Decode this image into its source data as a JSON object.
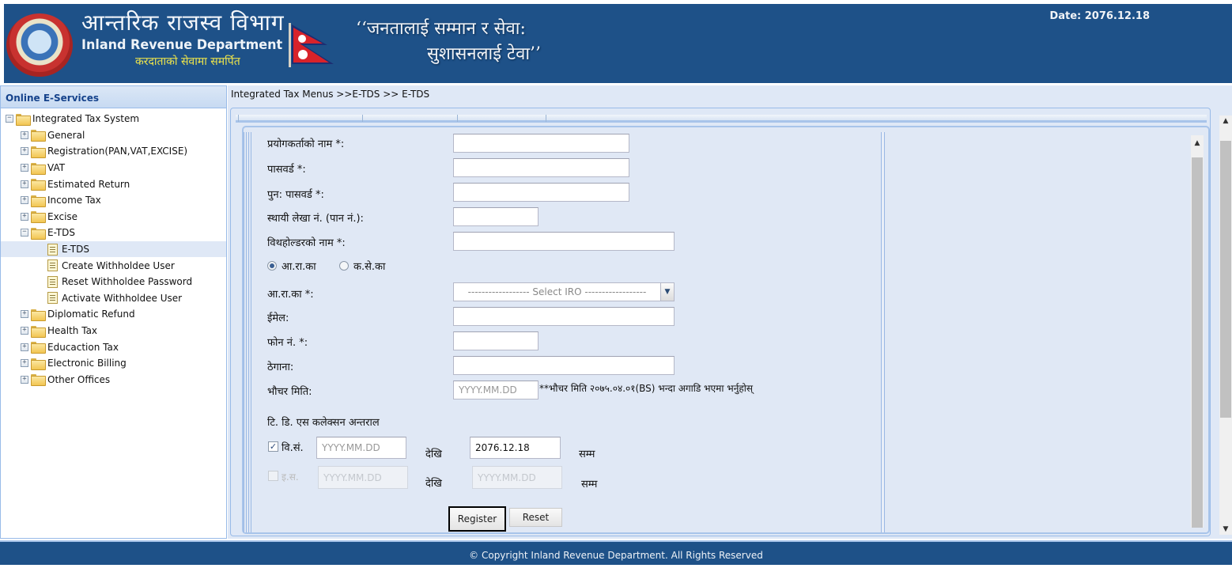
{
  "header": {
    "title_np": "आन्तरिक राजस्व विभाग",
    "title_en": "Inland Revenue Department",
    "tagline": "करदाताको सेवामा समर्पित",
    "slogan_line1": "‘‘जनतालाई सम्मान र सेवा:",
    "slogan_line2": "सुशासनलाई टेवा’’",
    "date_label": "Date:",
    "date_value": "2076.12.18"
  },
  "sidebar": {
    "title": "Online E-Services",
    "root": "Integrated Tax System",
    "items": [
      {
        "label": "General",
        "expanded": false
      },
      {
        "label": "Registration(PAN,VAT,EXCISE)",
        "expanded": false
      },
      {
        "label": "VAT",
        "expanded": false
      },
      {
        "label": "Estimated Return",
        "expanded": false
      },
      {
        "label": "Income Tax",
        "expanded": false
      },
      {
        "label": "Excise",
        "expanded": false
      },
      {
        "label": "E-TDS",
        "expanded": true,
        "children": [
          {
            "label": "E-TDS",
            "selected": true
          },
          {
            "label": "Create Withholdee User"
          },
          {
            "label": "Reset Withholdee Password"
          },
          {
            "label": "Activate Withholdee User"
          }
        ]
      },
      {
        "label": "Diplomatic Refund",
        "expanded": false
      },
      {
        "label": "Health Tax",
        "expanded": false
      },
      {
        "label": "Educaction Tax",
        "expanded": false
      },
      {
        "label": "Electronic Billing",
        "expanded": false
      },
      {
        "label": "Other Offices",
        "expanded": false
      }
    ]
  },
  "breadcrumb": "Integrated Tax Menus >>E-TDS >> E-TDS",
  "form": {
    "username_label": "प्रयोगकर्ताको नाम *:",
    "username_value": "",
    "password_label": "पासवर्ड *:",
    "password_value": "",
    "repassword_label": "पुन: पासवर्ड *:",
    "repassword_value": "",
    "pan_label": "स्थायी लेखा नं. (पान नं.):",
    "pan_value": "",
    "withholder_label": "विथहोल्डरको नाम *:",
    "withholder_value": "",
    "office_type_options": [
      {
        "label": "आ.रा.का",
        "checked": true
      },
      {
        "label": "क.से.का",
        "checked": false
      }
    ],
    "iro_label": "आ.रा.का *:",
    "iro_selected": "------------------ Select IRO ------------------",
    "email_label": "ईमेल:",
    "email_value": "",
    "phone_label": "फोन नं. *:",
    "phone_value": "",
    "address_label": "ठेगाना:",
    "address_value": "",
    "voucher_date_label": "भौचर मिति:",
    "voucher_date_placeholder": "YYYY.MM.DD",
    "voucher_note": "**भौचर मिति २०७५.०४.०१(BS) भन्दा अगाडि भएमा भर्नुहोस्",
    "interval_title": "टि. डि. एस कलेक्सन अन्तराल",
    "bs": {
      "label": "वि.सं.",
      "checked": true,
      "from_placeholder": "YYYY.MM.DD",
      "from_value": "",
      "from_suffix": "देखि",
      "to_value": "2076.12.18",
      "to_suffix": "सम्म"
    },
    "ad": {
      "label": "इ.स.",
      "checked": false,
      "disabled": true,
      "from_placeholder": "YYYY.MM.DD",
      "from_suffix": "देखि",
      "to_placeholder": "YYYY.MM.DD",
      "to_suffix": "सम्म"
    },
    "register_label": "Register",
    "reset_label": "Reset"
  },
  "footer": "© Copyright Inland Revenue Department. All Rights Reserved",
  "colors": {
    "header_bg": "#1e5188",
    "panel_bg": "#dfe8f6",
    "panel_border": "#99bbe8",
    "sidebar_title": "#15428b",
    "tagline": "#f0e64a"
  }
}
